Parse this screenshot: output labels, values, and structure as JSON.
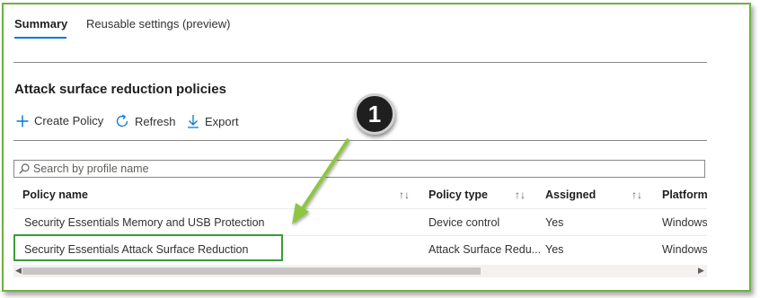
{
  "tabs": [
    {
      "label": "Summary",
      "active": true
    },
    {
      "label": "Reusable settings (preview)",
      "active": false
    }
  ],
  "section_title": "Attack surface reduction policies",
  "toolbar": {
    "create_label": "Create Policy",
    "refresh_label": "Refresh",
    "export_label": "Export"
  },
  "search": {
    "placeholder": "Search by profile name"
  },
  "table": {
    "columns": [
      "Policy name",
      "Policy type",
      "Assigned",
      "Platform"
    ],
    "rows": [
      {
        "name": "Security Essentials Memory and USB Protection",
        "type": "Device control",
        "assigned": "Yes",
        "platform": "Windows"
      },
      {
        "name": "Security Essentials Attack Surface Reduction",
        "type": "Attack Surface Redu...",
        "assigned": "Yes",
        "platform": "Windows"
      }
    ]
  },
  "callout": {
    "number": "1"
  },
  "colors": {
    "accent": "#0078d4",
    "highlight": "#3a9b3a",
    "frame": "#6db33f",
    "arrow": "#8dc63f"
  }
}
